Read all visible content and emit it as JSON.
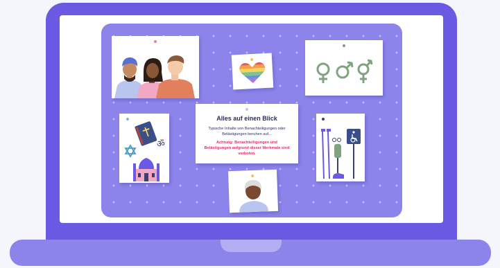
{
  "info_card": {
    "title": "Alles auf einen Blick",
    "intro": "Typische Inhalte von Benachteiligungen oder Belästigungen beruhen auf...",
    "warning": "Achtung: Benachteiligungen und Belästigungen aufgrund dieser Merkmale sind verboten."
  },
  "icons": {
    "ethnicity": "people-of-different-ethnicities-icon",
    "sexual_identity": "rainbow-heart-icon",
    "gender": "gender-symbols-icon",
    "religion": "religious-symbols-icon",
    "disability": "disability-aids-icon",
    "age": "elderly-person-icon"
  },
  "colors": {
    "laptop": "#6a59e2",
    "board": "#8c84ea",
    "text_dark": "#2a2f5b",
    "warning": "#e0306a",
    "gender_green": "#7fa37d"
  }
}
